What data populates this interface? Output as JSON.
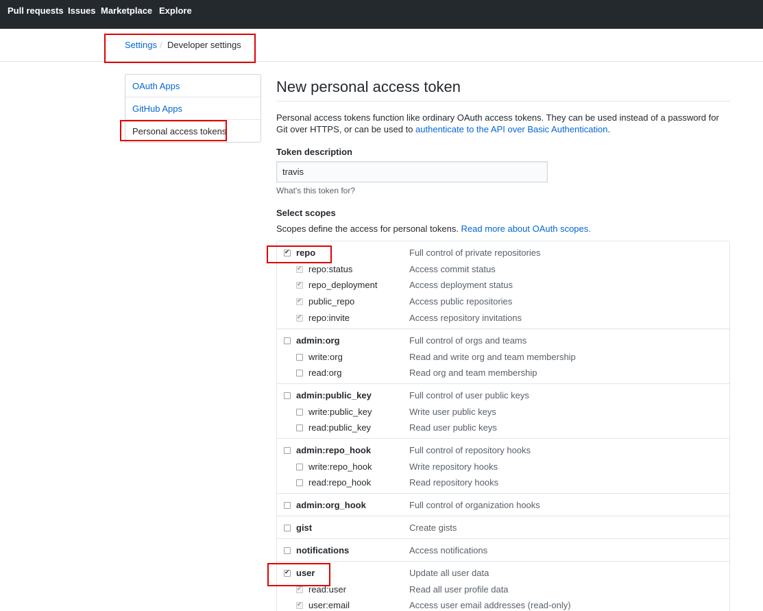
{
  "topnav": {
    "items": [
      "Pull requests",
      "Issues",
      "Marketplace",
      "Explore"
    ]
  },
  "breadcrumb": {
    "settings": "Settings",
    "separator": "/",
    "current": "Developer settings"
  },
  "sidebar": {
    "items": [
      "OAuth Apps",
      "GitHub Apps",
      "Personal access tokens"
    ],
    "selected_index": 2
  },
  "main": {
    "title": "New personal access token",
    "intro_text": "Personal access tokens function like ordinary OAuth access tokens. They can be used instead of a password for Git over HTTPS, or can be used to ",
    "intro_link": "authenticate to the API over Basic Authentication",
    "intro_end": ".",
    "token_label": "Token description",
    "token_value": "travis",
    "token_note": "What's this token for?",
    "scopes_label": "Select scopes",
    "scopes_help": "Scopes define the access for personal tokens. ",
    "scopes_link": "Read more about OAuth scopes."
  },
  "scopes": [
    {
      "name": "repo",
      "desc": "Full control of private repositories",
      "checked": true,
      "children": [
        {
          "name": "repo:status",
          "desc": "Access commit status",
          "checked": true
        },
        {
          "name": "repo_deployment",
          "desc": "Access deployment status",
          "checked": true
        },
        {
          "name": "public_repo",
          "desc": "Access public repositories",
          "checked": true
        },
        {
          "name": "repo:invite",
          "desc": "Access repository invitations",
          "checked": true
        }
      ]
    },
    {
      "name": "admin:org",
      "desc": "Full control of orgs and teams",
      "checked": false,
      "children": [
        {
          "name": "write:org",
          "desc": "Read and write org and team membership",
          "checked": false
        },
        {
          "name": "read:org",
          "desc": "Read org and team membership",
          "checked": false
        }
      ]
    },
    {
      "name": "admin:public_key",
      "desc": "Full control of user public keys",
      "checked": false,
      "children": [
        {
          "name": "write:public_key",
          "desc": "Write user public keys",
          "checked": false
        },
        {
          "name": "read:public_key",
          "desc": "Read user public keys",
          "checked": false
        }
      ]
    },
    {
      "name": "admin:repo_hook",
      "desc": "Full control of repository hooks",
      "checked": false,
      "children": [
        {
          "name": "write:repo_hook",
          "desc": "Write repository hooks",
          "checked": false
        },
        {
          "name": "read:repo_hook",
          "desc": "Read repository hooks",
          "checked": false
        }
      ]
    },
    {
      "name": "admin:org_hook",
      "desc": "Full control of organization hooks",
      "checked": false,
      "children": []
    },
    {
      "name": "gist",
      "desc": "Create gists",
      "checked": false,
      "children": []
    },
    {
      "name": "notifications",
      "desc": "Access notifications",
      "checked": false,
      "children": []
    },
    {
      "name": "user",
      "desc": "Update all user data",
      "checked": true,
      "children": [
        {
          "name": "read:user",
          "desc": "Read all user profile data",
          "checked": true
        },
        {
          "name": "user:email",
          "desc": "Access user email addresses (read-only)",
          "checked": true
        }
      ]
    }
  ],
  "colors": {
    "nav_bg": "#24292e",
    "link": "#0366d6",
    "annotation": "#e00000"
  }
}
